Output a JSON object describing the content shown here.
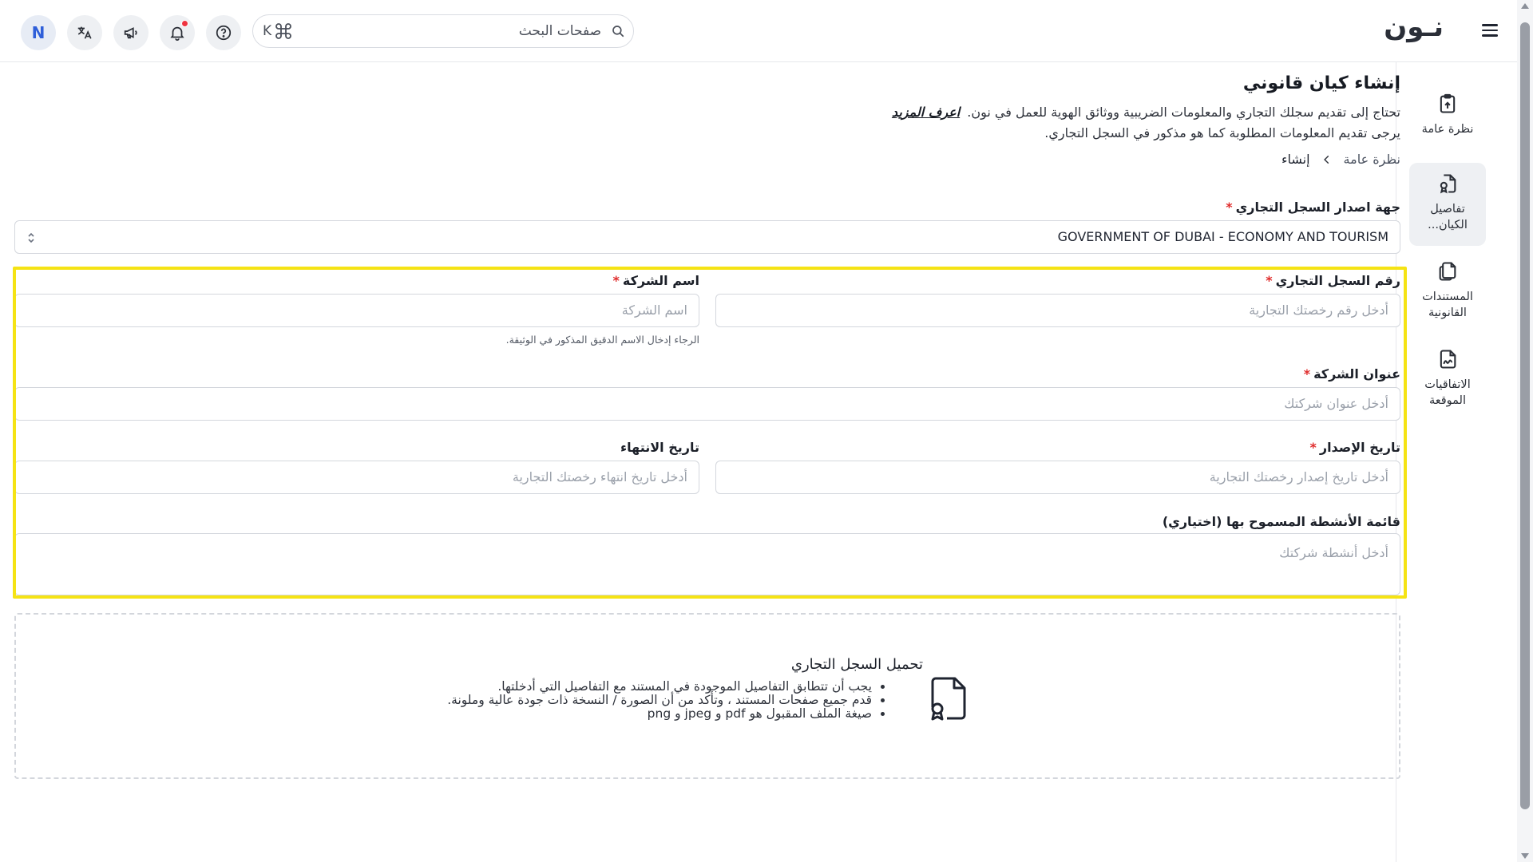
{
  "header": {
    "logo_text": "نـون",
    "search_placeholder": "صفحات البحث",
    "search_shortcut": "K",
    "avatar_initial": "N"
  },
  "sidebar": {
    "items": [
      {
        "label": "نظرة عامة",
        "icon": "clipboard-upload-icon",
        "active": false
      },
      {
        "label": "تفاصيل الكيان...",
        "icon": "file-badge-icon",
        "active": true
      },
      {
        "label": "المستندات القانونية",
        "icon": "copy-documents-icon",
        "active": false
      },
      {
        "label": "الاتفاقيات الموقعة",
        "icon": "file-signature-icon",
        "active": false
      }
    ]
  },
  "page": {
    "title": "إنشاء كيان قانوني",
    "intro_line1": "تحتاج إلى تقديم سجلك التجاري والمعلومات الضريبية ووثائق الهوية للعمل في نون.",
    "learn_more": "اعرف المزيد",
    "intro_line2": "يرجى تقديم المعلومات المطلوبة كما هو مذكور في السجل التجاري.",
    "breadcrumb": {
      "parent": "نظرة عامة",
      "current": "إنشاء"
    }
  },
  "form": {
    "issuer": {
      "label": "جهة اصدار السجل التجاري",
      "value": "GOVERNMENT OF DUBAI -  ECONOMY AND TOURISM"
    },
    "cr_number": {
      "label": "رقم السجل التجاري",
      "placeholder": "أدخل رقم رخصتك التجارية"
    },
    "company_name": {
      "label": "اسم الشركة",
      "placeholder": "اسم الشركة",
      "hint": "الرجاء إدخال الاسم الدقيق المذكور في الوثيقة."
    },
    "company_address": {
      "label": "عنوان الشركة",
      "placeholder": "أدخل عنوان شركتك"
    },
    "issue_date": {
      "label": "تاريخ الإصدار",
      "placeholder": "أدخل تاريخ إصدار رخصتك التجارية"
    },
    "expiry_date": {
      "label": "تاريخ الانتهاء",
      "placeholder": "أدخل تاريخ انتهاء رخصتك التجارية"
    },
    "activities": {
      "label": "قائمة الأنشطة المسموح بها (اختياري)",
      "placeholder": "أدخل أنشطة شركتك"
    },
    "required_mark": "*"
  },
  "upload": {
    "title": "تحميل السجل التجاري",
    "bullets": [
      "يجب أن تتطابق التفاصيل الموجودة في المستند مع التفاصيل التي أدخلتها.",
      "قدم جميع صفحات المستند ، وتأكد من أن الصورة / النسخة ذات جودة عالية وملونة.",
      "صيغة الملف المقبول هو pdf و jpeg و png"
    ]
  },
  "colors": {
    "highlight": "#f5e314",
    "required": "#e02d2d",
    "notification": "#ef3340"
  }
}
